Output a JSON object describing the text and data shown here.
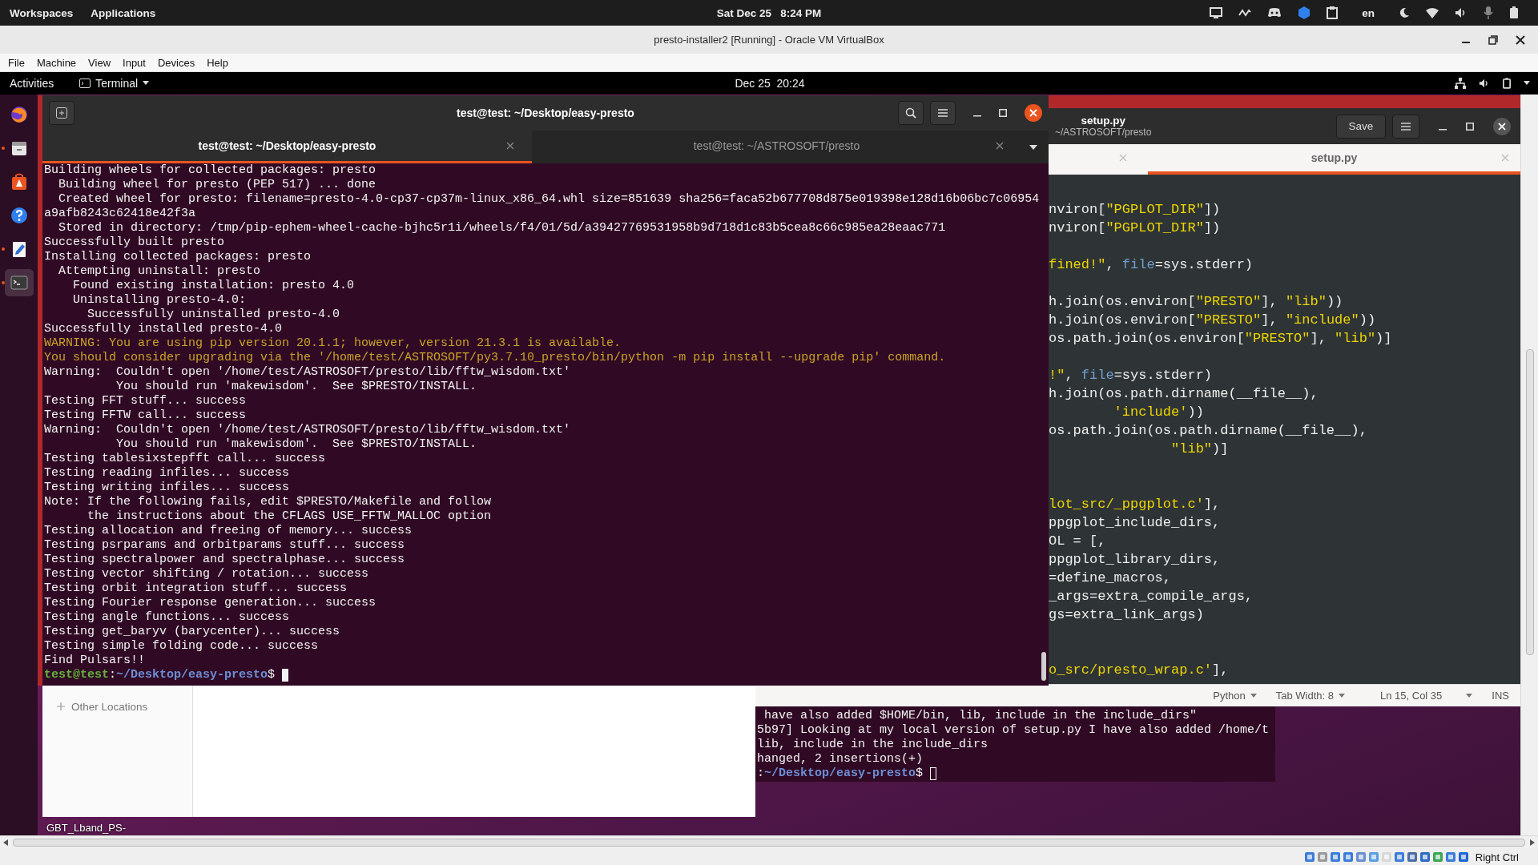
{
  "host_bar": {
    "menus": [
      "Workspaces",
      "Applications"
    ],
    "clock": "Sat Dec 25   8:24 PM",
    "language": "en"
  },
  "vbox": {
    "title": "presto-installer2 [Running] - Oracle VM VirtualBox",
    "menu": [
      "File",
      "Machine",
      "View",
      "Input",
      "Devices",
      "Help"
    ]
  },
  "guest_bar": {
    "activities": "Activities",
    "app": "Terminal",
    "clock": "Dec 25  20:24"
  },
  "dock": [
    {
      "kind": "firefox",
      "running": false,
      "selected": false
    },
    {
      "kind": "files",
      "running": true,
      "selected": false
    },
    {
      "kind": "software",
      "running": false,
      "selected": false
    },
    {
      "kind": "help",
      "running": false,
      "selected": false
    },
    {
      "kind": "editor",
      "running": true,
      "selected": false
    },
    {
      "kind": "terminal",
      "running": true,
      "selected": true
    }
  ],
  "terminal": {
    "title": "test@test: ~/Desktop/easy-presto",
    "tabs": [
      {
        "label": "test@test: ~/Desktop/easy-presto",
        "selected": true
      },
      {
        "label": "test@test: ~/ASTROSOFT/presto",
        "selected": false
      }
    ],
    "lines": [
      {
        "text": "Building wheels for collected packages: presto",
        "kind": "output"
      },
      {
        "text": "  Building wheel for presto (PEP 517) ... done",
        "kind": "output"
      },
      {
        "text": "  Created wheel for presto: filename=presto-4.0-cp37-cp37m-linux_x86_64.whl size=851639 sha256=faca52b677708d875e019398e128d16b06bc7c06954",
        "kind": "output"
      },
      {
        "text": "a9afb8243c62418e42f3a",
        "kind": "output"
      },
      {
        "text": "  Stored in directory: /tmp/pip-ephem-wheel-cache-bjhc5r1i/wheels/f4/01/5d/a39427769531958b9d718d1c83b5cea8c66c985ea28eaac771",
        "kind": "output"
      },
      {
        "text": "Successfully built presto",
        "kind": "output"
      },
      {
        "text": "Installing collected packages: presto",
        "kind": "output"
      },
      {
        "text": "  Attempting uninstall: presto",
        "kind": "output"
      },
      {
        "text": "    Found existing installation: presto 4.0",
        "kind": "output"
      },
      {
        "text": "    Uninstalling presto-4.0:",
        "kind": "output"
      },
      {
        "text": "      Successfully uninstalled presto-4.0",
        "kind": "output"
      },
      {
        "text": "Successfully installed presto-4.0",
        "kind": "output"
      },
      {
        "text": "WARNING: You are using pip version 20.1.1; however, version 21.3.1 is available.",
        "kind": "warning"
      },
      {
        "text": "You should consider upgrading via the '/home/test/ASTROSOFT/py3.7.10_presto/bin/python -m pip install --upgrade pip' command.",
        "kind": "warning"
      },
      {
        "text": "Warning:  Couldn't open '/home/test/ASTROSOFT/presto/lib/fftw_wisdom.txt'",
        "kind": "output"
      },
      {
        "text": "          You should run 'makewisdom'.  See $PRESTO/INSTALL.",
        "kind": "output"
      },
      {
        "text": "Testing FFT stuff... success",
        "kind": "output"
      },
      {
        "text": "Testing FFTW call... success",
        "kind": "output"
      },
      {
        "text": "Warning:  Couldn't open '/home/test/ASTROSOFT/presto/lib/fftw_wisdom.txt'",
        "kind": "output"
      },
      {
        "text": "          You should run 'makewisdom'.  See $PRESTO/INSTALL.",
        "kind": "output"
      },
      {
        "text": "Testing tablesixstepfft call... success",
        "kind": "output"
      },
      {
        "text": "Testing reading infiles... success",
        "kind": "output"
      },
      {
        "text": "Testing writing infiles... success",
        "kind": "output"
      },
      {
        "text": "Note: If the following fails, edit $PRESTO/Makefile and follow",
        "kind": "output"
      },
      {
        "text": "      the instructions about the CFLAGS USE_FFTW_MALLOC option",
        "kind": "output"
      },
      {
        "text": "Testing allocation and freeing of memory... success",
        "kind": "output"
      },
      {
        "text": "Testing psrparams and orbitparams stuff... success",
        "kind": "output"
      },
      {
        "text": "Testing spectralpower and spectralphase... success",
        "kind": "output"
      },
      {
        "text": "Testing vector shifting / rotation... success",
        "kind": "output"
      },
      {
        "text": "Testing orbit integration stuff... success",
        "kind": "output"
      },
      {
        "text": "Testing Fourier response generation... success",
        "kind": "output"
      },
      {
        "text": "Testing angle functions... success",
        "kind": "output"
      },
      {
        "text": "Testing get_baryv (barycenter)... success",
        "kind": "output"
      },
      {
        "text": "Testing simple folding code... success",
        "kind": "output"
      },
      {
        "text": "Find Pulsars!!",
        "kind": "output"
      }
    ],
    "prompt": {
      "user": "test@test",
      "sep": ":",
      "path": "~/Desktop/easy-presto",
      "symbol": "$"
    }
  },
  "editor": {
    "title": "setup.py",
    "subtitle": "~/ASTROSOFT/presto",
    "save": "Save",
    "tabs": [
      {
        "selected": false
      },
      {
        "label": "setup.py",
        "selected": true
      }
    ],
    "code": [
      {
        "kind": "code",
        "segments": [
          {
            "text": "nviron[",
            "kind": "plain"
          },
          {
            "text": "\"PGPLOT_DIR\"",
            "kind": "string"
          },
          {
            "text": "])",
            "kind": "plain"
          }
        ]
      },
      {
        "kind": "code",
        "segments": [
          {
            "text": "nviron[",
            "kind": "plain"
          },
          {
            "text": "\"PGPLOT_DIR\"",
            "kind": "string"
          },
          {
            "text": "])",
            "kind": "plain"
          }
        ]
      },
      {
        "kind": "blank"
      },
      {
        "kind": "code",
        "segments": [
          {
            "text": "fined!\"",
            "kind": "string"
          },
          {
            "text": ", ",
            "kind": "plain"
          },
          {
            "text": "file",
            "kind": "param"
          },
          {
            "text": "=sys.stderr)",
            "kind": "plain"
          }
        ]
      },
      {
        "kind": "blank"
      },
      {
        "kind": "code",
        "segments": [
          {
            "text": "h.join(os.environ[",
            "kind": "plain"
          },
          {
            "text": "\"PRESTO\"",
            "kind": "string"
          },
          {
            "text": "], ",
            "kind": "plain"
          },
          {
            "text": "\"lib\"",
            "kind": "string"
          },
          {
            "text": "))",
            "kind": "plain"
          }
        ]
      },
      {
        "kind": "code",
        "segments": [
          {
            "text": "h.join(os.environ[",
            "kind": "plain"
          },
          {
            "text": "\"PRESTO\"",
            "kind": "string"
          },
          {
            "text": "], ",
            "kind": "plain"
          },
          {
            "text": "\"include\"",
            "kind": "string"
          },
          {
            "text": "))",
            "kind": "plain"
          }
        ]
      },
      {
        "kind": "code",
        "segments": [
          {
            "text": "os.path.join(os.environ[",
            "kind": "plain"
          },
          {
            "text": "\"PRESTO\"",
            "kind": "string"
          },
          {
            "text": "], ",
            "kind": "plain"
          },
          {
            "text": "\"lib\"",
            "kind": "string"
          },
          {
            "text": ")]",
            "kind": "plain"
          }
        ]
      },
      {
        "kind": "blank"
      },
      {
        "kind": "code",
        "segments": [
          {
            "text": "!\"",
            "kind": "string"
          },
          {
            "text": ", ",
            "kind": "plain"
          },
          {
            "text": "file",
            "kind": "param"
          },
          {
            "text": "=sys.stderr)",
            "kind": "plain"
          }
        ]
      },
      {
        "kind": "code",
        "segments": [
          {
            "text": "h.join(os.path.dirname(__file__),",
            "kind": "plain"
          }
        ]
      },
      {
        "kind": "code",
        "segments": [
          {
            "text": "        'include'",
            "kind": "string"
          },
          {
            "text": "))",
            "kind": "plain"
          }
        ]
      },
      {
        "kind": "code",
        "segments": [
          {
            "text": "os.path.join(os.path.dirname(__file__),",
            "kind": "plain"
          }
        ]
      },
      {
        "kind": "code",
        "segments": [
          {
            "text": "               \"lib\"",
            "kind": "string"
          },
          {
            "text": ")]",
            "kind": "plain"
          }
        ]
      },
      {
        "kind": "blank"
      },
      {
        "kind": "blank"
      },
      {
        "kind": "code",
        "segments": [
          {
            "text": "lot_src/_ppgplot.c'",
            "kind": "string"
          },
          {
            "text": "],",
            "kind": "plain"
          }
        ]
      },
      {
        "kind": "code",
        "segments": [
          {
            "text": "ppgplot_include_dirs,",
            "kind": "plain"
          }
        ]
      },
      {
        "kind": "code",
        "segments": [
          {
            "text": "OL = [,",
            "kind": "plain"
          }
        ]
      },
      {
        "kind": "code",
        "segments": [
          {
            "text": "ppgplot_library_dirs,",
            "kind": "plain"
          }
        ]
      },
      {
        "kind": "code",
        "segments": [
          {
            "text": "=define_macros,",
            "kind": "plain"
          }
        ]
      },
      {
        "kind": "code",
        "segments": [
          {
            "text": "_args=extra_compile_args,",
            "kind": "plain"
          }
        ]
      },
      {
        "kind": "code",
        "segments": [
          {
            "text": "gs=extra_link_args)",
            "kind": "plain"
          }
        ]
      },
      {
        "kind": "blank"
      },
      {
        "kind": "blank"
      },
      {
        "kind": "code",
        "segments": [
          {
            "text": "o_src/presto_wrap.c'",
            "kind": "string"
          },
          {
            "text": "],",
            "kind": "plain"
          }
        ]
      }
    ],
    "status": {
      "language": "Python",
      "tab_width": "Tab Width: 8",
      "position": "Ln 15, Col 35",
      "mode": "INS"
    }
  },
  "files": {
    "sidebar": [
      {
        "label": "Other Locations"
      }
    ]
  },
  "back_terminal": {
    "lines": [
      " have also added $HOME/bin, lib, include in the include_dirs\"",
      "5b97] Looking at my local version of setup.py I have also added /home/t",
      "lib, include in the include_dirs",
      "hanged, 2 insertions(+)"
    ],
    "prompt": {
      "sep": ":",
      "path": "~/Desktop/easy-presto",
      "symbol": "$"
    }
  },
  "desktop_icons": [
    {
      "label": "GBT_Lband_PS-"
    }
  ],
  "status_bar": {
    "host_key": "Right Ctrl"
  }
}
